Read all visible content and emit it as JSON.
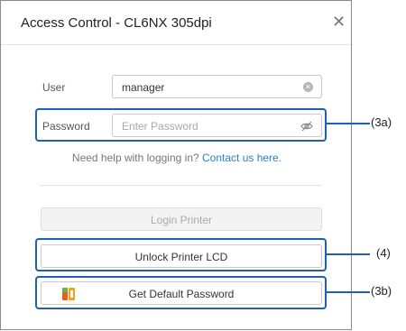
{
  "dialog": {
    "title": "Access Control - CL6NX 305dpi",
    "close_glyph": "✕"
  },
  "form": {
    "user_label": "User",
    "user_value": "manager",
    "password_label": "Password",
    "password_placeholder": "Enter Password",
    "help_text": "Need help with logging in? ",
    "help_link": "Contact us here."
  },
  "buttons": {
    "login": "Login Printer",
    "unlock": "Unlock Printer LCD",
    "default_password": "Get Default Password"
  },
  "callouts": {
    "password": "(3a)",
    "unlock": "(4)",
    "default_password": "(3b)"
  },
  "icons": {
    "clear": "clear-icon",
    "eye": "eye-off-icon",
    "close": "close-icon",
    "app": "app-icon"
  },
  "colors": {
    "highlight": "#1f5fb5",
    "link": "#2a7fd3"
  }
}
